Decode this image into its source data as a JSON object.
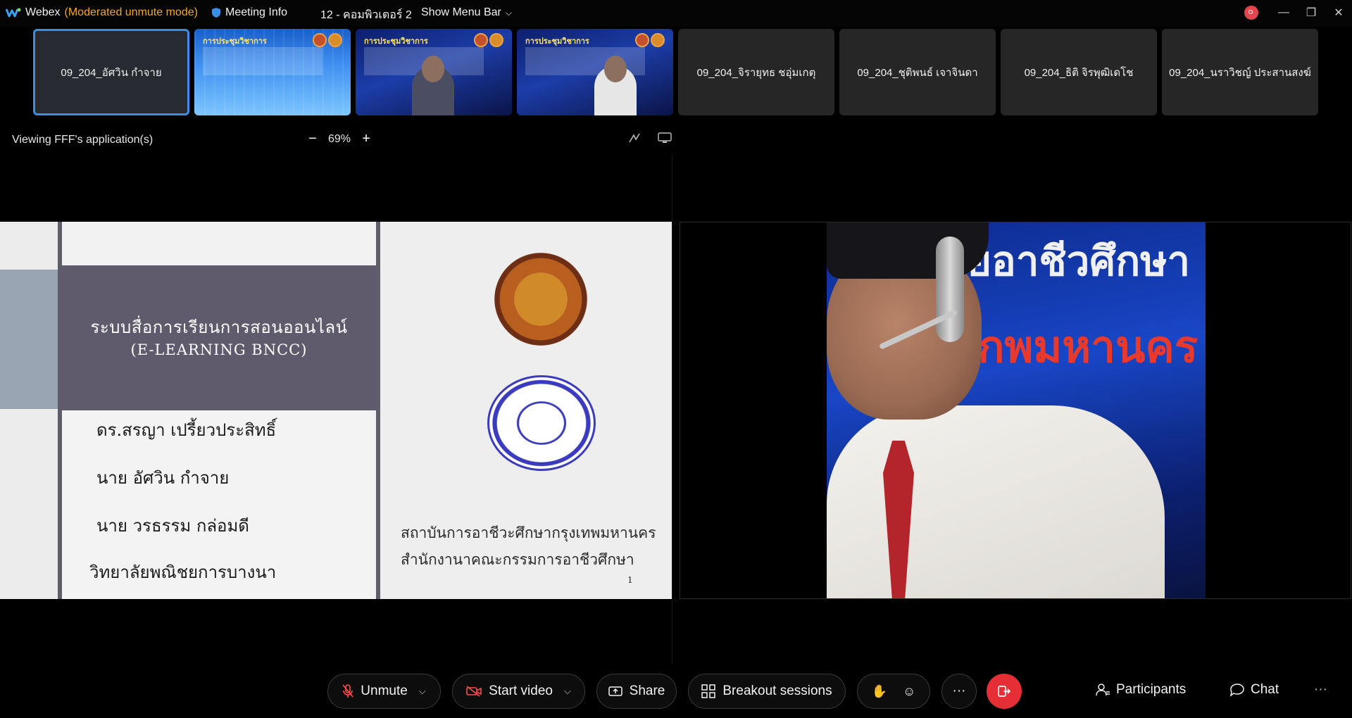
{
  "titlebar": {
    "app_name": "Webex",
    "mode": "(Moderated unmute mode)",
    "meeting_info": "Meeting Info",
    "meeting_name": "12 - คอมพิวเตอร์ 2",
    "menu_bar": "Show Menu Bar"
  },
  "thumbnails": [
    {
      "name": "09_204_อัศวิน กำจาย",
      "type": "name",
      "active": true
    },
    {
      "name": "การประชุมวิชาการ",
      "type": "video"
    },
    {
      "name": "การประชุมวิชาการ",
      "type": "video"
    },
    {
      "name": "การประชุมวิชาการ",
      "type": "video"
    },
    {
      "name": "09_204_จิรายุทธ ชอุ่มเกตุ",
      "type": "name"
    },
    {
      "name": "09_204_ชุติพนธ์ เจาจินดา",
      "type": "name"
    },
    {
      "name": "09_204_ธิติ จิรพุฒิเดโช",
      "type": "name"
    },
    {
      "name": "09_204_นราวิชญ์ ประสานสงฆ์",
      "type": "name"
    }
  ],
  "share": {
    "viewing_label": "Viewing FFF's application(s)",
    "zoom_level": "69%",
    "zoom_out": "−",
    "zoom_in": "+"
  },
  "slide": {
    "title_th": "ระบบสื่อการเรียนการสอนออนไลน์",
    "title_en": "(E-LEARNING BNCC)",
    "names": [
      "ดร.สรญา เปรี้ยวประสิทธิ์",
      "นาย อัศวิน กำจาย",
      "นาย วรธรรม กล่อมดี"
    ],
    "college": "วิทยาลัยพณิชยการบางนา",
    "institute": "สถาบันการอาชีวะศึกษากรุงเทพมหานคร",
    "office": "สำนักงานาคณะกรรมการอาชีวศึกษา",
    "page_number": "1"
  },
  "video": {
    "banner_line1": "ยอาชีวศึกษา",
    "banner_line2": "กพมหานคร"
  },
  "controls": {
    "unmute": "Unmute",
    "start_video": "Start video",
    "share": "Share",
    "breakout": "Breakout sessions",
    "more": "···",
    "participants": "Participants",
    "chat": "Chat",
    "overflow": "···"
  },
  "colors": {
    "accent_blue": "#3a8ee6",
    "mode_orange": "#f5a623",
    "leave_red": "#e52e36",
    "slide_band": "#5f5b6c"
  }
}
